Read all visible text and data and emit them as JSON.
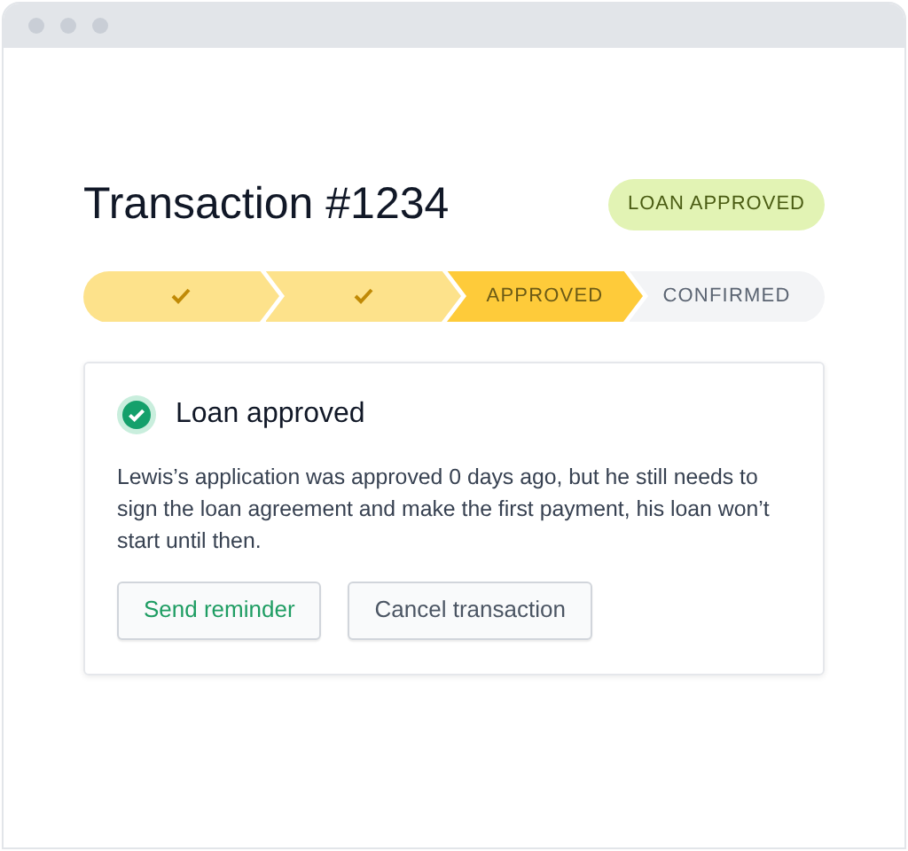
{
  "title": "Transaction #1234",
  "badge": "LOAN APPROVED",
  "steps": [
    {
      "kind": "done"
    },
    {
      "kind": "done"
    },
    {
      "kind": "current",
      "label": "APPROVED"
    },
    {
      "kind": "pending",
      "label": "CONFIRMED"
    }
  ],
  "card": {
    "title": "Loan approved",
    "body": "Lewis’s application was approved 0 days ago, but he still needs to sign the loan agreement and make the first payment, his loan won’t start until then.",
    "buttons": [
      {
        "label": "Send reminder",
        "kind": "primary"
      },
      {
        "label": "Cancel transaction",
        "kind": "secondary"
      }
    ]
  }
}
